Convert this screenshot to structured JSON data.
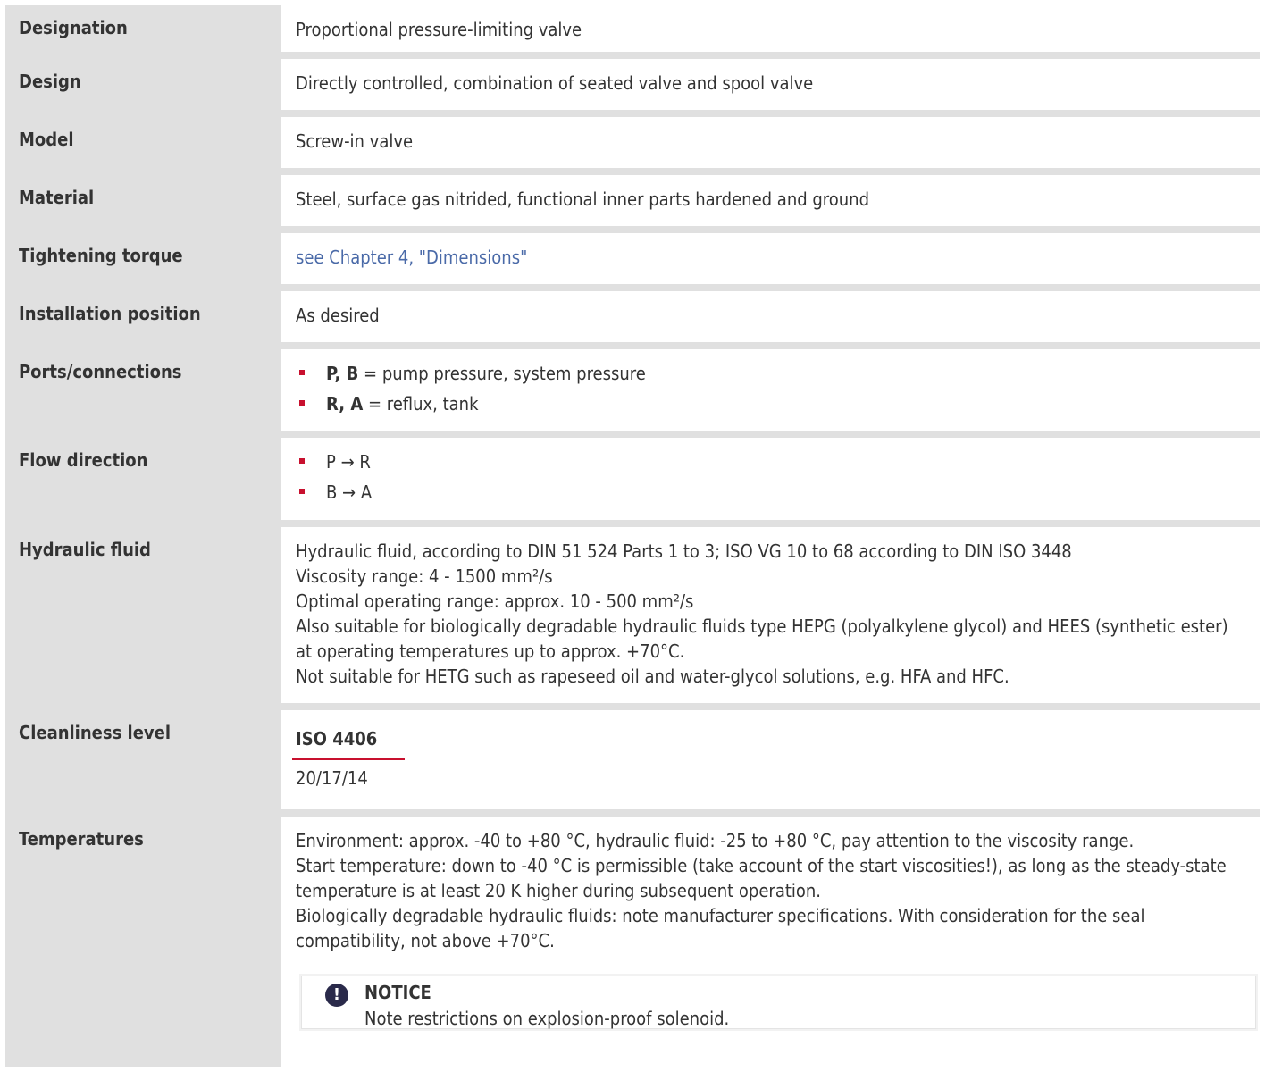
{
  "rows": {
    "designation": {
      "label": "Designation",
      "value": "Proportional pressure-limiting valve"
    },
    "design": {
      "label": "Design",
      "value": "Directly controlled, combination of seated valve and spool valve"
    },
    "model": {
      "label": "Model",
      "value": "Screw-in valve"
    },
    "material": {
      "label": "Material",
      "value": "Steel, surface gas nitrided, functional inner parts hardened and ground"
    },
    "tightening": {
      "label": "Tightening torque",
      "link": "see Chapter 4, \"Dimensions\""
    },
    "installation": {
      "label": "Installation position",
      "value": "As desired"
    },
    "ports": {
      "label": "Ports/connections",
      "items": [
        {
          "key": "P, B",
          "text": " = pump pressure, system pressure"
        },
        {
          "key": "R, A",
          "text": " = reflux, tank"
        }
      ]
    },
    "flow": {
      "label": "Flow direction",
      "items": [
        "P → R",
        "B → A"
      ]
    },
    "hydraulic": {
      "label": "Hydraulic fluid",
      "lines": [
        "Hydraulic fluid, according to DIN 51 524 Parts 1 to 3; ISO VG 10 to 68 according to DIN ISO 3448",
        "Viscosity range: 4 - 1500 mm²/s",
        "Optimal operating range: approx. 10 - 500 mm²/s",
        "Also suitable for biologically degradable hydraulic fluids type HEPG (polyalkylene glycol) and HEES (synthetic ester) at operating temperatures up to approx. +70°C.",
        "Not suitable for HETG such as rapeseed oil and water-glycol solutions, e.g. HFA and HFC."
      ]
    },
    "cleanliness": {
      "label": "Cleanliness level",
      "header": "ISO 4406",
      "value": "20/17/14"
    },
    "temperatures": {
      "label": "Temperatures",
      "lines": [
        "Environment: approx. -40 to +80 °C, hydraulic fluid: -25 to +80 °C, pay attention to the viscosity range.",
        "Start temperature: down to -40 °C is permissible (take account of the start viscosities!), as long as the steady-state temperature is at least 20 K higher during subsequent operation.",
        "Biologically degradable hydraulic fluids: note manufacturer specifications. With consideration for the seal compatibility, not above +70°C."
      ],
      "notice": {
        "icon": "exclamation-icon",
        "title": "NOTICE",
        "text": "Note restrictions on explosion-proof solenoid."
      }
    }
  },
  "colors": {
    "accent": "#c8102e",
    "link": "#4a6aa8",
    "label_bg": "#e0e0e0"
  }
}
